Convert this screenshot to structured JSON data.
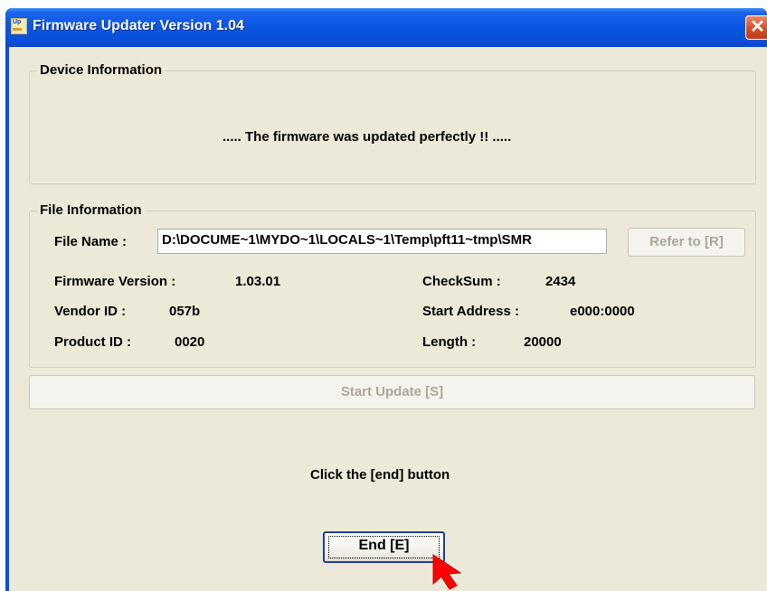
{
  "window": {
    "title": "Firmware Updater Version 1.04",
    "icon": "updater-app-icon",
    "close_glyph": "✕"
  },
  "device_info": {
    "legend": "Device Information",
    "message": "..... The firmware was updated perfectly !! ....."
  },
  "file_info": {
    "legend": "File Information",
    "file_name_label": "File Name :",
    "file_name_value": "D:\\DOCUME~1\\MYDO~1\\LOCALS~1\\Temp\\pft11~tmp\\SMR",
    "refer_button": "Refer to [R]",
    "firmware_version_label": "Firmware Version :",
    "firmware_version_value": "1.03.01",
    "checksum_label": "CheckSum :",
    "checksum_value": "2434",
    "vendor_id_label": "Vendor ID :",
    "vendor_id_value": "057b",
    "start_address_label": "Start Address :",
    "start_address_value": "e000:0000",
    "product_id_label": "Product ID :",
    "product_id_value": "0020",
    "length_label": "Length :",
    "length_value": "20000"
  },
  "start_update_button": "Start Update [S]",
  "instruction": "Click the [end] button",
  "end_button": "End [E]",
  "colors": {
    "titlebar": "#0a4fd6",
    "client": "#ece9d8",
    "close_button": "#d24a22",
    "cursor_arrow": "#ff0000"
  }
}
